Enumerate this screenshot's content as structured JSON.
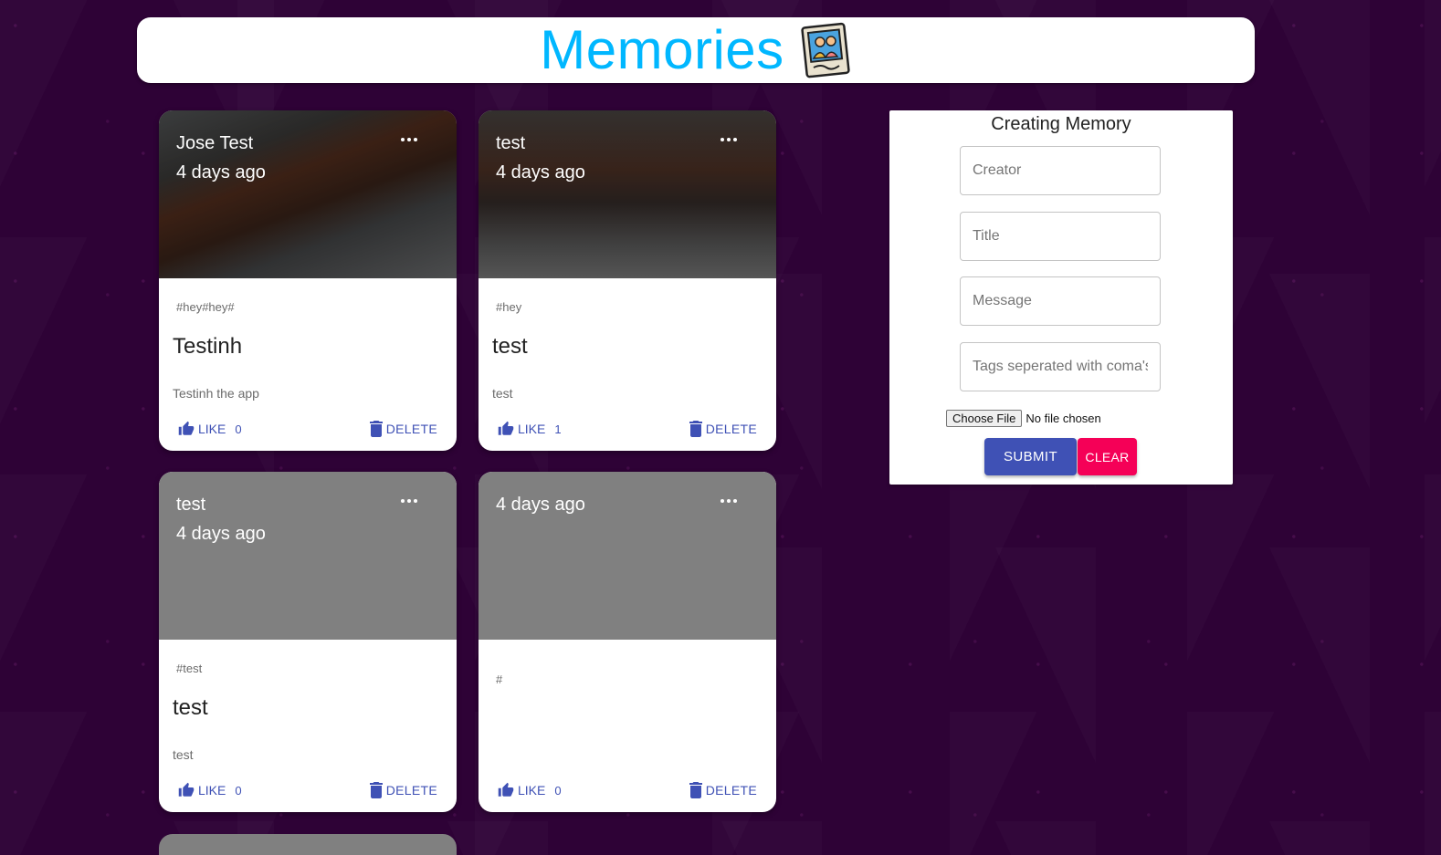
{
  "header": {
    "title": "Memories",
    "logo_icon": "memories-photo-icon"
  },
  "posts": [
    {
      "creator": "Jose Test",
      "time": "4 days ago",
      "tags": "#hey#hey#",
      "title": "Testinh",
      "message": "Testinh the app",
      "like_label": "LIKE",
      "like_count": "0",
      "delete_label": "DELETE",
      "has_image": true
    },
    {
      "creator": "test",
      "time": "4 days ago",
      "tags": "#hey",
      "title": "test",
      "message": "test",
      "like_label": "LIKE",
      "like_count": "1",
      "delete_label": "DELETE",
      "has_image": true
    },
    {
      "creator": "test",
      "time": "4 days ago",
      "tags": "#test",
      "title": "test",
      "message": "test",
      "like_label": "LIKE",
      "like_count": "0",
      "delete_label": "DELETE",
      "has_image": false
    },
    {
      "creator": "",
      "time": "4 days ago",
      "tags": "#",
      "title": "",
      "message": "",
      "like_label": "LIKE",
      "like_count": "0",
      "delete_label": "DELETE",
      "has_image": false
    }
  ],
  "form": {
    "heading": "Creating Memory",
    "creator_placeholder": "Creator",
    "title_placeholder": "Title",
    "message_placeholder": "Message",
    "tags_placeholder": "Tags seperated with coma's",
    "file_button": "Choose File",
    "file_status": "No file chosen",
    "submit_label": "SUBMIT",
    "clear_label": "CLEAR"
  },
  "colors": {
    "background": "#2e0236",
    "brand_title": "#00b7ff",
    "primary": "#3f51b5",
    "secondary": "#f50057",
    "card_placeholder": "#808080"
  }
}
